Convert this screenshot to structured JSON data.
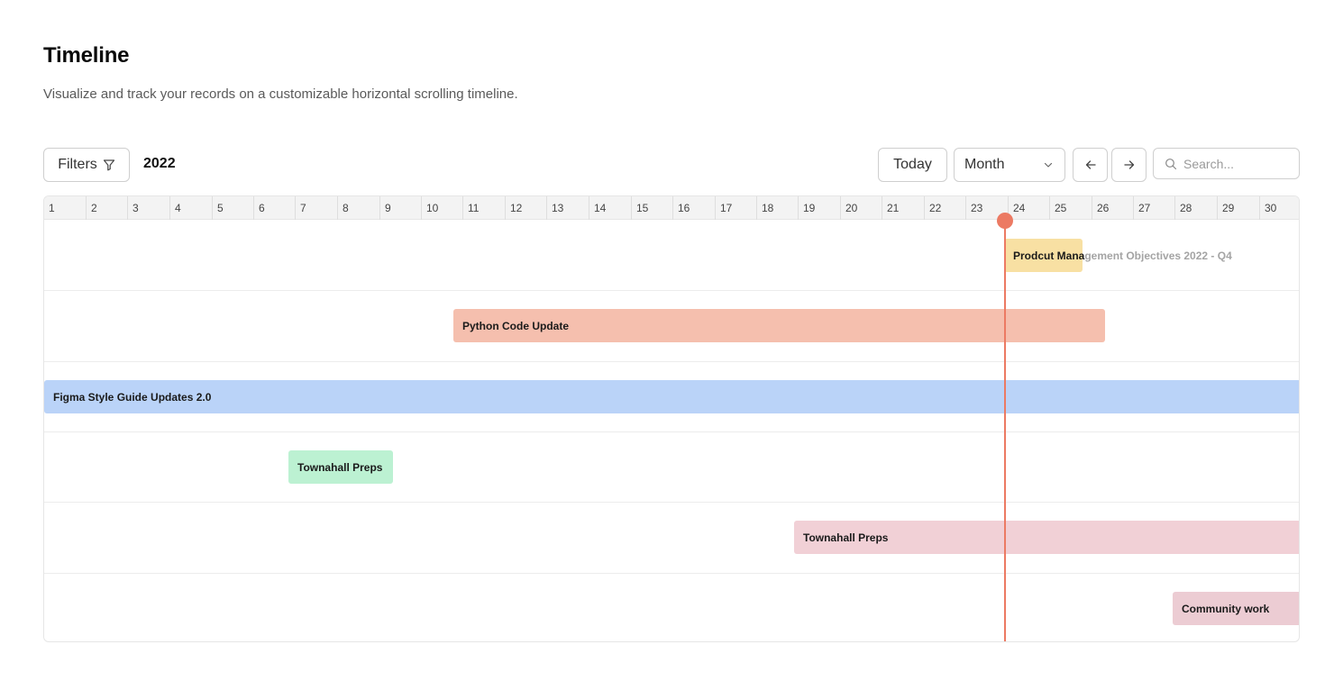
{
  "header": {
    "title": "Timeline",
    "subtitle": "Visualize and track your records on a customizable horizontal scrolling timeline."
  },
  "toolbar": {
    "filters_label": "Filters",
    "year": "2022",
    "today_label": "Today",
    "view_select": {
      "value": "Month",
      "options": [
        "Month"
      ]
    },
    "search_placeholder": "Search..."
  },
  "icons": {
    "filter": "filter-icon",
    "chevron": "chevron-down-icon",
    "prev": "arrow-left-icon",
    "next": "arrow-right-icon",
    "search": "search-icon"
  },
  "timeline": {
    "days": [
      "1",
      "2",
      "3",
      "4",
      "5",
      "6",
      "7",
      "8",
      "9",
      "10",
      "11",
      "12",
      "13",
      "14",
      "15",
      "16",
      "17",
      "18",
      "19",
      "20",
      "21",
      "22",
      "23",
      "24",
      "25",
      "26",
      "27",
      "28",
      "29",
      "30"
    ],
    "today_color": "#ec7a63",
    "records": [
      {
        "label": "Prodcut Mana",
        "overflow_label": "gement Objectives 2022 - Q4",
        "color": "#f8e0a3"
      },
      {
        "label": "Python Code Update",
        "overflow_label": "",
        "color": "#f5bfae"
      },
      {
        "label": "Figma Style Guide Updates 2.0",
        "overflow_label": "",
        "color": "#bad3f8"
      },
      {
        "label": "Townahall Preps",
        "overflow_label": "",
        "color": "#bcf1d2"
      },
      {
        "label": "Townahall Preps",
        "overflow_label": "",
        "color": "#f1d0d6"
      },
      {
        "label": "Community work",
        "overflow_label": "",
        "color": "#ecccd3"
      }
    ]
  }
}
